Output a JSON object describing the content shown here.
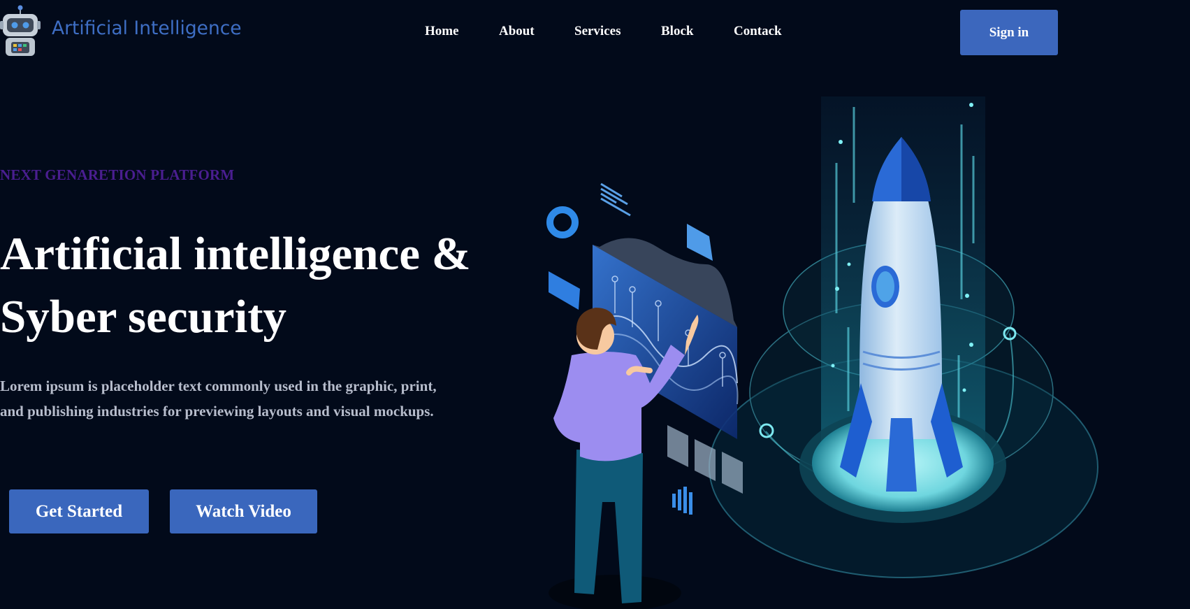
{
  "brand": {
    "name": "Artificial Intelligence",
    "logo_icon": "robot-icon"
  },
  "nav": [
    {
      "label": "Home"
    },
    {
      "label": "About"
    },
    {
      "label": "Services"
    },
    {
      "label": "Block"
    },
    {
      "label": "Contack"
    }
  ],
  "header": {
    "signin_label": "Sign in"
  },
  "hero": {
    "eyebrow": "NEXT GENARETION PLATFORM",
    "title_line1": "Artificial intelligence &",
    "title_line2": "Syber security",
    "description_line1": "Lorem ipsum is placeholder text commonly used in the graphic, print,",
    "description_line2": "and publishing industries for previewing layouts and visual mockups.",
    "primary_button": "Get Started",
    "secondary_button": "Watch Video"
  },
  "illustration": {
    "subject": "rocket-launch-illustration"
  },
  "colors": {
    "background": "#020a1a",
    "accent": "#3c67bd",
    "eyebrow": "#4a1e90",
    "brand_text": "#3e6ec4",
    "body_text": "#b7bdcc"
  }
}
